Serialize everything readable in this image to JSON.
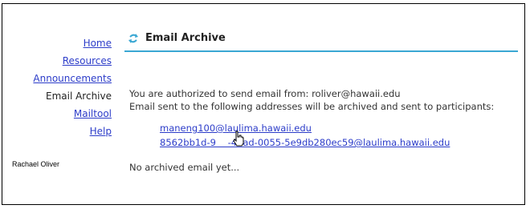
{
  "nav": {
    "items": [
      {
        "label": "Home",
        "link": true
      },
      {
        "label": "Resources",
        "link": true
      },
      {
        "label": "Announcements",
        "link": true
      },
      {
        "label": "Email Archive",
        "link": false
      },
      {
        "label": "Mailtool",
        "link": true
      },
      {
        "label": "Help",
        "link": true
      }
    ],
    "user_name": "Rachael Oliver"
  },
  "header": {
    "title": "Email Archive",
    "icon": "refresh-arrows-icon",
    "accent_color": "#3aa7d3"
  },
  "main": {
    "authorized_text": "You are authorized to send email from: roliver@hawaii.edu",
    "archived_note": "Email sent to the following addresses will be archived and sent to participants:",
    "addresses": [
      "maneng100@laulima.hawaii.edu",
      "8562bb1d-9    -4dad-0055-5e9db280ec59@laulima.hawaii.edu"
    ],
    "empty_text": "No archived email yet..."
  },
  "colors": {
    "link": "#2c3cc9",
    "text": "#333333"
  }
}
